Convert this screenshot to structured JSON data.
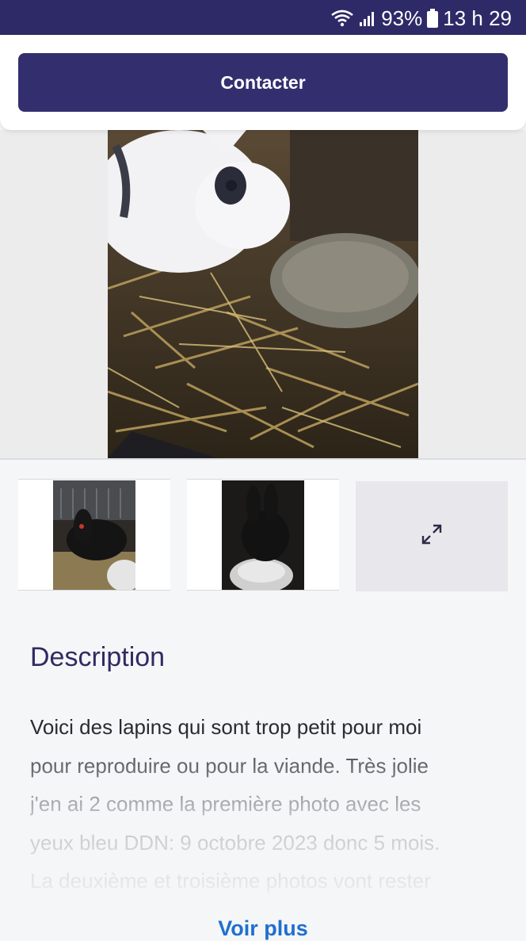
{
  "status_bar": {
    "battery": "93%",
    "time": "13 h 29",
    "icons": [
      "wifi-icon",
      "signal-icon",
      "battery-icon"
    ]
  },
  "header": {
    "contact_label": "Contacter"
  },
  "gallery": {
    "main_photo": "rabbit-white-eating-pellets",
    "thumbnails": [
      "black-rabbit-in-carrier",
      "black-rabbit-drinking"
    ],
    "expand_icon": "expand-icon"
  },
  "description": {
    "title": "Description",
    "text": "Voici des lapins qui sont trop petit pour moi\npour reproduire ou pour la viande. Très jolie\nj'en ai 2 comme la première photo avec les\nyeux bleu DDN: 9 octobre 2023 donc 5 mois.\nLa deuxième et troisième photos vont rester",
    "see_more": "Voir plus"
  },
  "colors": {
    "status_bar": "#2e2a68",
    "button": "#332f6f",
    "title": "#2f2b63",
    "link": "#1f6fd1"
  }
}
